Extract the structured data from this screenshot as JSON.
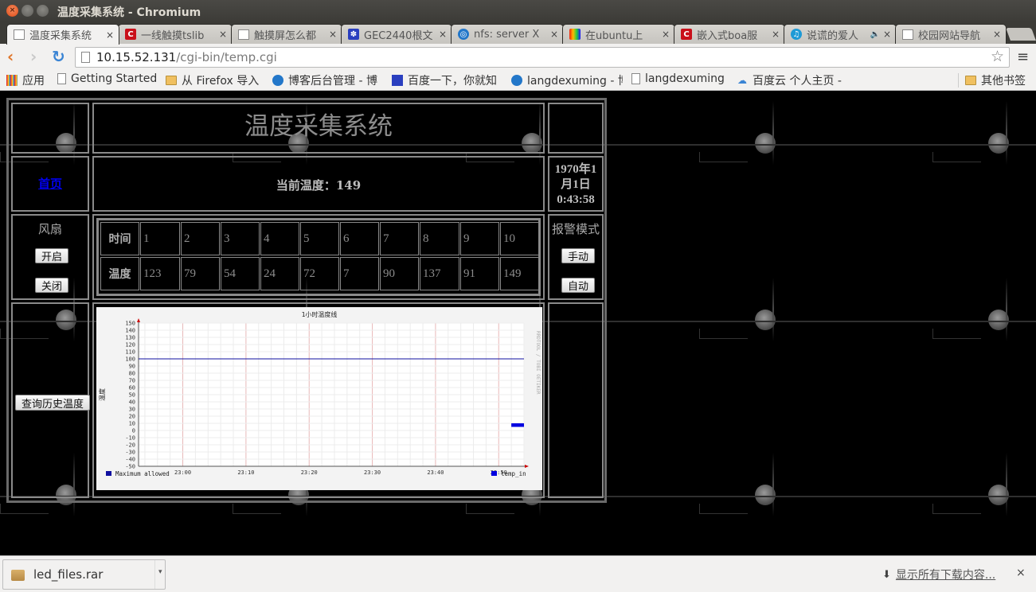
{
  "window": {
    "title": "温度采集系统 - Chromium",
    "controls": {
      "close": "×",
      "minimize": "–",
      "maximize": "□"
    }
  },
  "tabs": [
    {
      "title": "温度采集系统",
      "icon": "page-icon",
      "active": true
    },
    {
      "title": "一线触摸tslib",
      "icon": "csdn-icon",
      "active": false
    },
    {
      "title": "触摸屏怎么都",
      "icon": "page-icon",
      "active": false
    },
    {
      "title": "GEC2440根文",
      "icon": "baidu-paw-icon",
      "active": false
    },
    {
      "title": "nfs: server X",
      "icon": "blog-icon",
      "active": false
    },
    {
      "title": "在ubuntu上",
      "icon": "colorful-icon",
      "active": false
    },
    {
      "title": "嵌入式boa服",
      "icon": "csdn-icon",
      "active": false
    },
    {
      "title": "说谎的爱人",
      "icon": "music-icon",
      "active": false,
      "audio": "🔈"
    },
    {
      "title": "校园网站导航",
      "icon": "page-icon",
      "active": false
    }
  ],
  "toolbar": {
    "url_host": "10.15.52.131",
    "url_path": "/cgi-bin/temp.cgi",
    "star": "☆",
    "menu": "≡"
  },
  "bookmarks": {
    "items": [
      {
        "label": "应用",
        "icon": "apps-icon"
      },
      {
        "label": "Getting Started",
        "icon": "page-icon"
      },
      {
        "label": "从 Firefox 导入",
        "icon": "folder-icon"
      },
      {
        "label": "博客后台管理 - 博",
        "icon": "blog-icon"
      },
      {
        "label": "百度一下，你就知",
        "icon": "baidu-paw-icon"
      },
      {
        "label": "langdexuming - 博",
        "icon": "blog-icon"
      },
      {
        "label": "langdexuming",
        "icon": "page-icon"
      },
      {
        "label": "百度云 个人主页 -",
        "icon": "cloud-icon"
      }
    ],
    "other": "其他书签"
  },
  "page": {
    "title": "温度采集系统",
    "home_link": "首页",
    "current_temp_label": "当前温度：",
    "current_temp_value": "149",
    "datetime_lines": [
      "1970年1",
      "月1日",
      "0:43:58"
    ],
    "fan": {
      "label": "风扇",
      "on": "开启",
      "off": "关闭"
    },
    "alarm": {
      "label": "报警模式",
      "manual": "手动",
      "auto": "自动"
    },
    "history_button": "查询历史温度",
    "table": {
      "row_headers": [
        "时间",
        "温度"
      ],
      "times": [
        "1",
        "2",
        "3",
        "4",
        "5",
        "6",
        "7",
        "8",
        "9",
        "10"
      ],
      "temps": [
        "123",
        "79",
        "54",
        "24",
        "72",
        "7",
        "90",
        "137",
        "91",
        "149"
      ]
    }
  },
  "chart_data": {
    "type": "line",
    "title": "1小时温度线",
    "ylabel": "温度",
    "xlabel": "",
    "side_label": "RRDTOOL / TOBI OETIKER",
    "ylim": [
      -50,
      150
    ],
    "yticks": [
      150,
      140,
      130,
      120,
      110,
      100,
      90,
      80,
      70,
      60,
      50,
      40,
      30,
      20,
      10,
      0,
      -10,
      -20,
      -30,
      -40,
      -50
    ],
    "xticks": [
      "23:00",
      "23:10",
      "23:20",
      "23:30",
      "23:40",
      "23:50"
    ],
    "xlim_minutes": [
      -7,
      54
    ],
    "grid": true,
    "series": [
      {
        "name": "Maximum allowed",
        "color": "#1010a0",
        "kind": "hline",
        "value": 100
      },
      {
        "name": "temp_in",
        "color": "#0000e0",
        "kind": "area",
        "x_minutes": [
          52,
          54
        ],
        "values": [
          10,
          10
        ],
        "y_min": 5
      }
    ],
    "legend": [
      "Maximum allowed",
      "temp_in"
    ],
    "legend_placement": "bottom"
  },
  "downloads": {
    "items": [
      {
        "name": "led_files.rar"
      }
    ],
    "show_all": "显示所有下载内容...",
    "close": "×"
  }
}
